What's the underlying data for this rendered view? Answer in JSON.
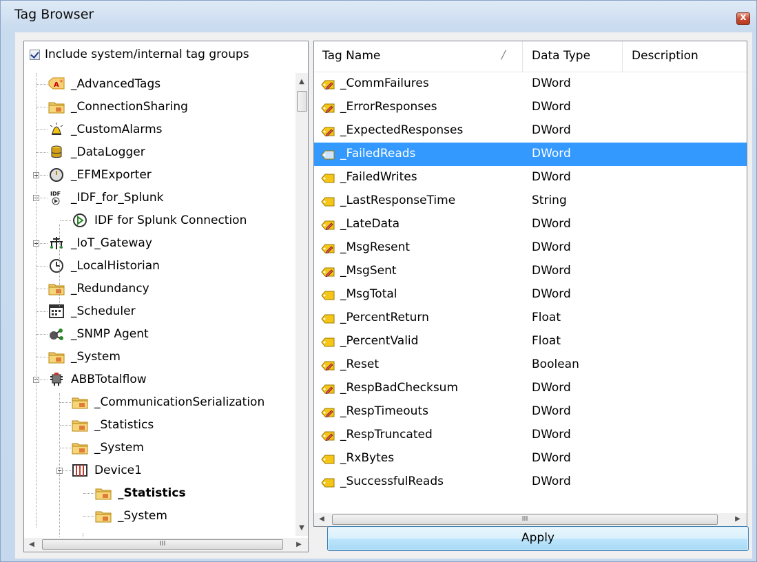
{
  "window": {
    "title": "Tag Browser",
    "close_glyph": "x"
  },
  "left": {
    "include_label": "Include system/internal tag groups",
    "include_checked": true,
    "tree": [
      {
        "label": "_AdvancedTags",
        "icon": "advanced-tags-icon",
        "level": 0,
        "expander": null,
        "bold": false
      },
      {
        "label": "_ConnectionSharing",
        "icon": "folder-icon",
        "level": 0,
        "expander": null,
        "bold": false
      },
      {
        "label": "_CustomAlarms",
        "icon": "alarm-bell-icon",
        "level": 0,
        "expander": null,
        "bold": false
      },
      {
        "label": "_DataLogger",
        "icon": "database-icon",
        "level": 0,
        "expander": null,
        "bold": false
      },
      {
        "label": "_EFMExporter",
        "icon": "gauge-icon",
        "level": 0,
        "expander": "plus",
        "bold": false
      },
      {
        "label": "_IDF_for_Splunk",
        "icon": "idf-icon",
        "level": 0,
        "expander": "minus",
        "bold": false
      },
      {
        "label": "IDF for Splunk Connection",
        "icon": "play-circle-icon",
        "level": 1,
        "expander": null,
        "bold": false
      },
      {
        "label": "_IoT_Gateway",
        "icon": "network-icon",
        "level": 0,
        "expander": "plus",
        "bold": false
      },
      {
        "label": "_LocalHistorian",
        "icon": "history-icon",
        "level": 0,
        "expander": null,
        "bold": false
      },
      {
        "label": "_Redundancy",
        "icon": "folder-icon",
        "level": 0,
        "expander": null,
        "bold": false
      },
      {
        "label": "_Scheduler",
        "icon": "calendar-icon",
        "level": 0,
        "expander": null,
        "bold": false
      },
      {
        "label": "_SNMP Agent",
        "icon": "snmp-icon",
        "level": 0,
        "expander": null,
        "bold": false
      },
      {
        "label": "_System",
        "icon": "folder-icon",
        "level": 0,
        "expander": null,
        "bold": false
      },
      {
        "label": "ABBTotalflow",
        "icon": "channel-icon",
        "level": 0,
        "expander": "minus",
        "bold": false
      },
      {
        "label": "_CommunicationSerialization",
        "icon": "folder-icon",
        "level": 1,
        "expander": null,
        "bold": false
      },
      {
        "label": "_Statistics",
        "icon": "folder-icon",
        "level": 1,
        "expander": null,
        "bold": false
      },
      {
        "label": "_System",
        "icon": "folder-icon",
        "level": 1,
        "expander": null,
        "bold": false
      },
      {
        "label": "Device1",
        "icon": "device-icon",
        "level": 1,
        "expander": "minus",
        "bold": false
      },
      {
        "label": "_Statistics",
        "icon": "folder-icon",
        "level": 2,
        "expander": null,
        "bold": true
      },
      {
        "label": "_System",
        "icon": "folder-icon",
        "level": 2,
        "expander": null,
        "bold": false
      }
    ],
    "hscroll_grip": "III"
  },
  "right": {
    "columns": [
      "Tag Name",
      "Data Type",
      "Description"
    ],
    "sort_indicator": "/",
    "rows": [
      {
        "name": "_CommFailures",
        "type": "DWord",
        "icon": "tag-pencil-icon"
      },
      {
        "name": "_ErrorResponses",
        "type": "DWord",
        "icon": "tag-pencil-icon"
      },
      {
        "name": "_ExpectedResponses",
        "type": "DWord",
        "icon": "tag-pencil-icon"
      },
      {
        "name": "_FailedReads",
        "type": "DWord",
        "icon": "tag-icon"
      },
      {
        "name": "_FailedWrites",
        "type": "DWord",
        "icon": "tag-icon"
      },
      {
        "name": "_LastResponseTime",
        "type": "String",
        "icon": "tag-icon"
      },
      {
        "name": "_LateData",
        "type": "DWord",
        "icon": "tag-pencil-icon"
      },
      {
        "name": "_MsgResent",
        "type": "DWord",
        "icon": "tag-pencil-icon"
      },
      {
        "name": "_MsgSent",
        "type": "DWord",
        "icon": "tag-pencil-icon"
      },
      {
        "name": "_MsgTotal",
        "type": "DWord",
        "icon": "tag-icon"
      },
      {
        "name": "_PercentReturn",
        "type": "Float",
        "icon": "tag-icon"
      },
      {
        "name": "_PercentValid",
        "type": "Float",
        "icon": "tag-icon"
      },
      {
        "name": "_Reset",
        "type": "Boolean",
        "icon": "tag-pencil-icon"
      },
      {
        "name": "_RespBadChecksum",
        "type": "DWord",
        "icon": "tag-pencil-icon"
      },
      {
        "name": "_RespTimeouts",
        "type": "DWord",
        "icon": "tag-pencil-icon"
      },
      {
        "name": "_RespTruncated",
        "type": "DWord",
        "icon": "tag-pencil-icon"
      },
      {
        "name": "_RxBytes",
        "type": "DWord",
        "icon": "tag-icon"
      },
      {
        "name": "_SuccessfulReads",
        "type": "DWord",
        "icon": "tag-icon"
      }
    ],
    "selected_row": "_FailedReads",
    "hscroll_grip": "III"
  },
  "apply_label": "Apply",
  "colors": {
    "selection": "#3399ff",
    "tag_yellow": "#f2c200",
    "pencil": "#c0504d"
  }
}
